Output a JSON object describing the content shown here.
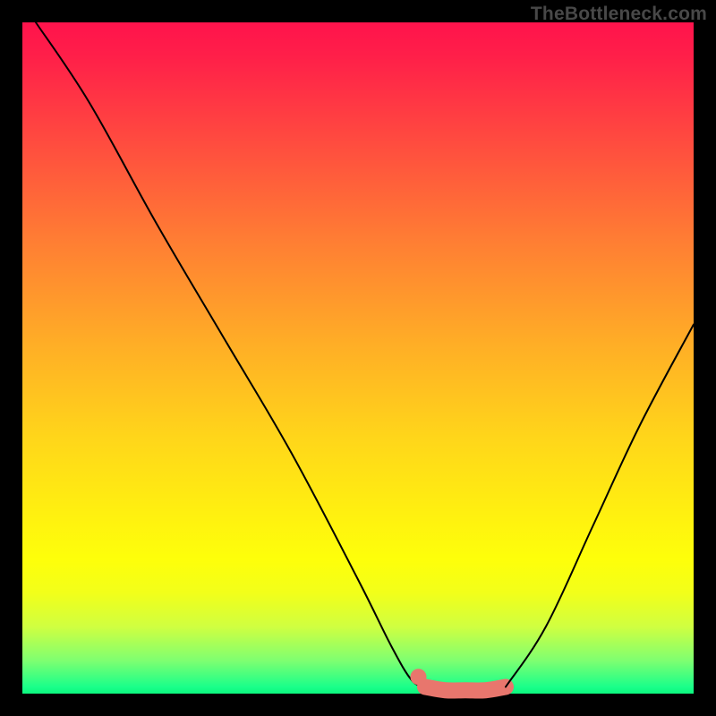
{
  "attribution": "TheBottleneck.com",
  "colors": {
    "background": "#000000",
    "gradient_top": "#ff134c",
    "gradient_bottom": "#0cf77e",
    "curve": "#000000",
    "highlight": "#e8766d"
  },
  "chart_data": {
    "type": "line",
    "title": "",
    "xlabel": "",
    "ylabel": "",
    "xlim": [
      0,
      100
    ],
    "ylim": [
      0,
      100
    ],
    "series": [
      {
        "name": "left-branch",
        "x": [
          2,
          10,
          20,
          30,
          40,
          50,
          55,
          58,
          60
        ],
        "y": [
          100,
          88,
          70,
          53,
          36,
          17,
          7,
          2,
          1
        ]
      },
      {
        "name": "right-branch",
        "x": [
          72,
          78,
          85,
          92,
          100
        ],
        "y": [
          1,
          10,
          25,
          40,
          55
        ]
      },
      {
        "name": "plateau-highlight",
        "x": [
          60,
          63,
          66,
          69,
          72
        ],
        "y": [
          1,
          0.5,
          0.5,
          0.5,
          1
        ]
      }
    ],
    "annotations": [
      {
        "name": "marker-left",
        "x": 59,
        "y": 2.5
      }
    ]
  }
}
